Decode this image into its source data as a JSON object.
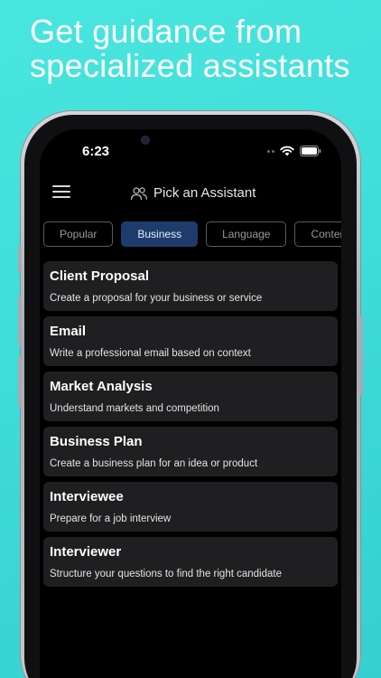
{
  "headline": {
    "line1": "Get guidance from",
    "line2": "specialized assistants"
  },
  "status_bar": {
    "time": "6:23"
  },
  "header": {
    "title": "Pick an Assistant"
  },
  "tabs": [
    {
      "label": "Popular",
      "active": false
    },
    {
      "label": "Business",
      "active": true
    },
    {
      "label": "Language",
      "active": false
    },
    {
      "label": "Content",
      "active": false
    }
  ],
  "assistants": [
    {
      "title": "Client Proposal",
      "description": "Create a proposal for your business or service"
    },
    {
      "title": "Email",
      "description": "Write a professional email based on context"
    },
    {
      "title": "Market Analysis",
      "description": "Understand markets and competition"
    },
    {
      "title": "Business Plan",
      "description": "Create a business plan for an idea or product"
    },
    {
      "title": "Interviewee",
      "description": "Prepare for a job interview"
    },
    {
      "title": "Interviewer",
      "description": "Structure your questions to find the right candidate"
    }
  ],
  "colors": {
    "background": "#3fdbd8",
    "active_tab": "#1d3c6b",
    "card": "#1f1f21"
  },
  "icons": {
    "menu": "hamburger-icon",
    "header": "people-icon",
    "wifi": "wifi-icon",
    "battery": "battery-icon"
  }
}
